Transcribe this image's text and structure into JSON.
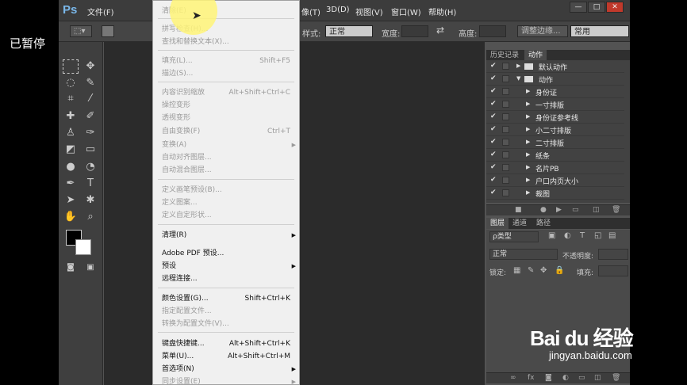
{
  "overlay": {
    "paused_text": "已暂停"
  },
  "menubar": {
    "logo": "Ps",
    "items": [
      "文件(F)",
      "像(T)",
      "3D(D)",
      "视图(V)",
      "窗口(W)",
      "帮助(H)"
    ],
    "window_buttons": [
      "—",
      "□",
      "✕"
    ]
  },
  "options": {
    "style_label": "样式:",
    "style_value": "正常",
    "width_label": "宽度:",
    "height_label": "高度:",
    "refine_edge": "调整边缘...",
    "workspace": "常用"
  },
  "dropdown": {
    "items": [
      {
        "label": "清除(E)",
        "shortcut": "",
        "disabled": true
      },
      {
        "label": "拼写检查(H)...",
        "shortcut": "",
        "disabled": true
      },
      {
        "label": "查找和替换文本(X)...",
        "shortcut": "",
        "disabled": true
      },
      {
        "label": "填充(L)...",
        "shortcut": "Shift+F5",
        "disabled": true
      },
      {
        "label": "描边(S)...",
        "shortcut": "",
        "disabled": true
      },
      {
        "label": "内容识别缩放",
        "shortcut": "Alt+Shift+Ctrl+C",
        "disabled": true
      },
      {
        "label": "操控变形",
        "shortcut": "",
        "disabled": true
      },
      {
        "label": "透视变形",
        "shortcut": "",
        "disabled": true
      },
      {
        "label": "自由变换(F)",
        "shortcut": "Ctrl+T",
        "disabled": true
      },
      {
        "label": "变换(A)",
        "shortcut": "",
        "disabled": true,
        "submenu": true
      },
      {
        "label": "自动对齐图层...",
        "shortcut": "",
        "disabled": true
      },
      {
        "label": "自动混合图层...",
        "shortcut": "",
        "disabled": true
      },
      {
        "label": "定义画笔预设(B)...",
        "shortcut": "",
        "disabled": true
      },
      {
        "label": "定义图案...",
        "shortcut": "",
        "disabled": true
      },
      {
        "label": "定义自定形状...",
        "shortcut": "",
        "disabled": true
      },
      {
        "label": "清理(R)",
        "shortcut": "",
        "disabled": false,
        "submenu": true
      },
      {
        "label": "Adobe PDF 预设...",
        "shortcut": "",
        "disabled": false
      },
      {
        "label": "预设",
        "shortcut": "",
        "disabled": false,
        "submenu": true
      },
      {
        "label": "远程连接...",
        "shortcut": "",
        "disabled": false
      },
      {
        "label": "颜色设置(G)...",
        "shortcut": "Shift+Ctrl+K",
        "disabled": false
      },
      {
        "label": "指定配置文件...",
        "shortcut": "",
        "disabled": true
      },
      {
        "label": "转换为配置文件(V)...",
        "shortcut": "",
        "disabled": true
      },
      {
        "label": "键盘快捷键...",
        "shortcut": "Alt+Shift+Ctrl+K",
        "disabled": false
      },
      {
        "label": "菜单(U)...",
        "shortcut": "Alt+Shift+Ctrl+M",
        "disabled": false
      },
      {
        "label": "首选项(N)",
        "shortcut": "",
        "disabled": false,
        "submenu": true
      },
      {
        "label": "同步设置(E)",
        "shortcut": "",
        "disabled": true,
        "submenu": true
      }
    ]
  },
  "actions_panel": {
    "tabs": [
      "历史记录",
      "动作"
    ],
    "rows": [
      {
        "label": "默认动作",
        "kind": "set"
      },
      {
        "label": "动作",
        "kind": "set-open"
      },
      {
        "label": "身份证",
        "kind": "action"
      },
      {
        "label": "一寸排版",
        "kind": "action"
      },
      {
        "label": "身份证参考线",
        "kind": "action"
      },
      {
        "label": "小二寸排版",
        "kind": "action"
      },
      {
        "label": "二寸排版",
        "kind": "action"
      },
      {
        "label": "纸条",
        "kind": "action"
      },
      {
        "label": "名片PB",
        "kind": "action"
      },
      {
        "label": "户口内页大小",
        "kind": "action"
      },
      {
        "label": "裁图",
        "kind": "action"
      }
    ]
  },
  "layers_panel": {
    "tabs": [
      "图层",
      "通道",
      "路径"
    ],
    "kind_filter": "ρ类型",
    "blend_mode": "正常",
    "opacity_label": "不透明度:",
    "lock_label": "锁定:",
    "fill_label": "填充:"
  },
  "watermark": {
    "logo": "Bai du 经验",
    "url": "jingyan.baidu.com"
  }
}
